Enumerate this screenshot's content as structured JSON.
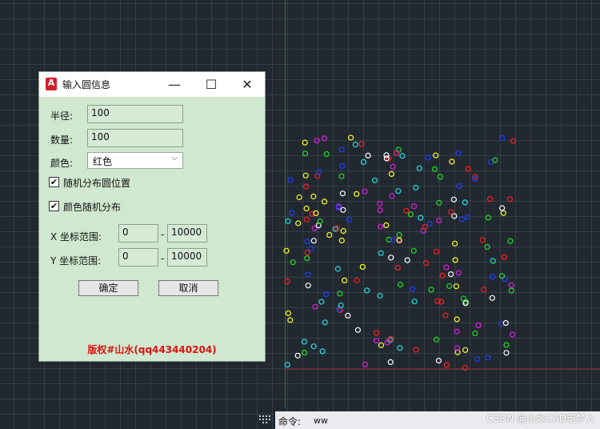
{
  "dialog": {
    "title": "输入圆信息",
    "app_icon_letter": "A",
    "minimize_glyph": "—",
    "maximize_glyph": "☐",
    "close_glyph": "✕",
    "radius_label": "半径:",
    "radius_value": "100",
    "count_label": "数量:",
    "count_value": "100",
    "color_label": "颜色:",
    "color_selected": "红色",
    "random_position_label": "随机分布圆位置",
    "random_position_checked": true,
    "random_color_label": "颜色随机分布",
    "random_color_checked": true,
    "x_range_label": "X 坐标范围:",
    "x_min": "0",
    "x_max": "10000",
    "y_range_label": "Y 坐标范围:",
    "y_min": "0",
    "y_max": "10000",
    "range_separator": "-",
    "ok_label": "确定",
    "cancel_label": "取消",
    "copyright": "版权#山水(qq443440204)",
    "check_glyph": "✔"
  },
  "command_line": {
    "prompt": "命令:",
    "value": "ww"
  },
  "watermark": "CSDN @山水CAD筑梦人",
  "colors": {
    "canvas_bg": "#212830",
    "dialog_bg": "#cfe8cf",
    "copyright_red": "#e01010",
    "circle_palette": [
      "#ff2020",
      "#20e020",
      "#2040ff",
      "#ffff20",
      "#20e0e0",
      "#e020e0",
      "#ffffff"
    ]
  },
  "drawing": {
    "circle_count": 100
  }
}
